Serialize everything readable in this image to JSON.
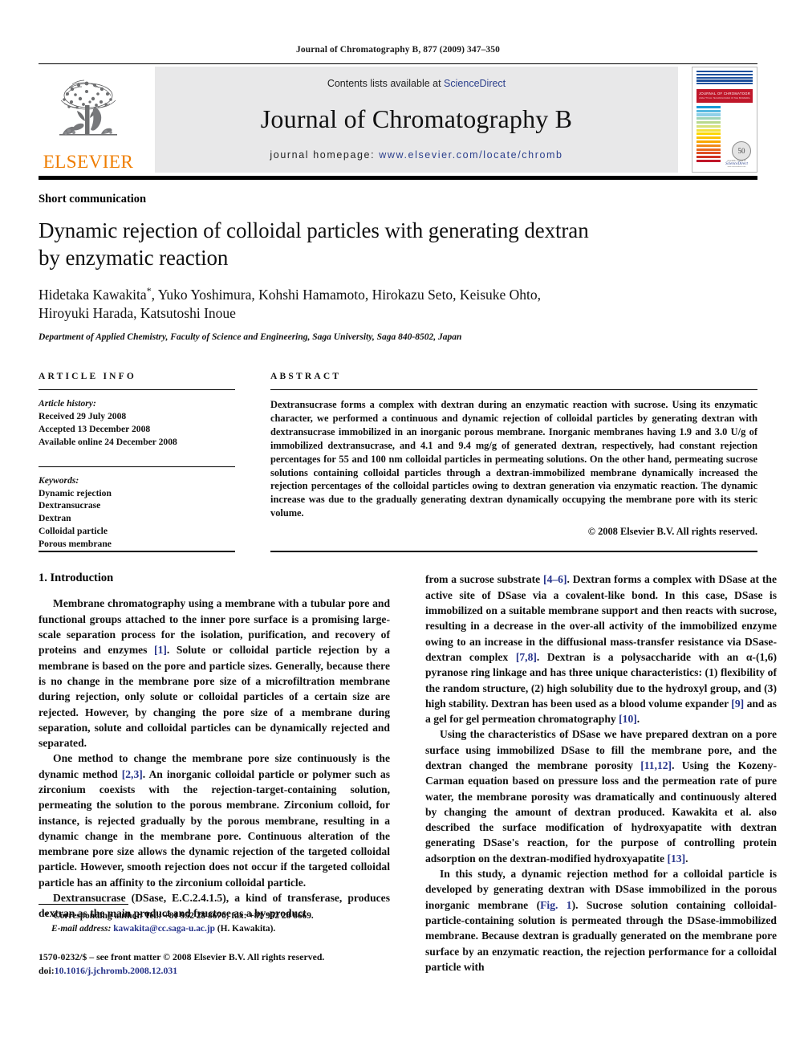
{
  "running_head": "Journal of Chromatography B, 877 (2009) 347–350",
  "masthead": {
    "publisher_name": "ELSEVIER",
    "contents_prefix": "Contents lists available at ",
    "contents_link": "ScienceDirect",
    "journal_title": "Journal of Chromatography B",
    "homepage_prefix": "journal homepage: ",
    "homepage_url": "www.elsevier.com/locate/chromb"
  },
  "cover": {
    "title": "JOURNAL OF CHROMATOGRAPHY B",
    "subtitle": "ANALYTICAL TECHNOLOGIES IN THE BIOMEDICAL AND LIFE SCIENCES",
    "badge": "50",
    "sd_top": "Available online at",
    "sd_name": "ScienceDirect",
    "sd_bottom": "www.sciencedirect.com",
    "top_bar_colors": [
      "#1b4f9c",
      "#1b4f9c",
      "#1b4f9c",
      "#1b4f9c",
      "#1b4f9c"
    ],
    "stripe_colors": [
      "#1a9ad6",
      "#55b8e0",
      "#8fd0e8",
      "#9ed3b7",
      "#b8d98e",
      "#d7e17a",
      "#f2e23a",
      "#fcd800",
      "#fcc200",
      "#f9a800",
      "#f18a1c",
      "#e96a20",
      "#de4d24",
      "#cf3224",
      "#c0172a"
    ]
  },
  "article": {
    "doctype": "Short communication",
    "title_line1": "Dynamic rejection of colloidal particles with generating dextran",
    "title_line2": "by enzymatic reaction",
    "authors_line1": "Hidetaka Kawakita",
    "authors_star": "*",
    "authors_line1_rest": ", Yuko Yoshimura, Kohshi Hamamoto, Hirokazu Seto, Keisuke Ohto,",
    "authors_line2": "Hiroyuki Harada, Katsutoshi Inoue",
    "affiliation": "Department of Applied Chemistry, Faculty of Science and Engineering, Saga University, Saga 840-8502, Japan"
  },
  "article_info": {
    "heading": "ARTICLE INFO",
    "history_label": "Article history:",
    "history": [
      "Received 29 July 2008",
      "Accepted 13 December 2008",
      "Available online 24 December 2008"
    ],
    "keywords_label": "Keywords:",
    "keywords": [
      "Dynamic rejection",
      "Dextransucrase",
      "Dextran",
      "Colloidal particle",
      "Porous membrane"
    ]
  },
  "abstract": {
    "heading": "ABSTRACT",
    "text": "Dextransucrase forms a complex with dextran during an enzymatic reaction with sucrose. Using its enzymatic character, we performed a continuous and dynamic rejection of colloidal particles by generating dextran with dextransucrase immobilized in an inorganic porous membrane. Inorganic membranes having 1.9 and 3.0 U/g of immobilized dextransucrase, and 4.1 and 9.4 mg/g of generated dextran, respectively, had constant rejection percentages for 55 and 100 nm colloidal particles in permeating solutions. On the other hand, permeating sucrose solutions containing colloidal particles through a dextran-immobilized membrane dynamically increased the rejection percentages of the colloidal particles owing to dextran generation via enzymatic reaction. The dynamic increase was due to the gradually generating dextran dynamically occupying the membrane pore with its steric volume.",
    "copyright": "© 2008 Elsevier B.V. All rights reserved."
  },
  "body": {
    "section_number_title": "1.  Introduction",
    "left_paragraphs": [
      "Membrane chromatography using a membrane with a tubular pore and functional groups attached to the inner pore surface is a promising large-scale separation process for the isolation, purification, and recovery of proteins and enzymes [1]. Solute or colloidal particle rejection by a membrane is based on the pore and particle sizes. Generally, because there is no change in the membrane pore size of a microfiltration membrane during rejection, only solute or colloidal particles of a certain size are rejected. However, by changing the pore size of a membrane during separation, solute and colloidal particles can be dynamically rejected and separated.",
      "One method to change the membrane pore size continuously is the dynamic method [2,3]. An inorganic colloidal particle or polymer such as zirconium coexists with the rejection-target-containing solution, permeating the solution to the porous membrane. Zirconium colloid, for instance, is rejected gradually by the porous membrane, resulting in a dynamic change in the membrane pore. Continuous alteration of the membrane pore size allows the dynamic rejection of the targeted colloidal particle. However, smooth rejection does not occur if the targeted colloidal particle has an affinity to the zirconium colloidal particle.",
      "Dextransucrase (DSase, E.C.2.4.1.5), a kind of transferase, produces dextran as the main product and fructose as a by-product"
    ],
    "right_paragraphs": [
      "from a sucrose substrate [4–6]. Dextran forms a complex with DSase at the active site of DSase via a covalent-like bond. In this case, DSase is immobilized on a suitable membrane support and then reacts with sucrose, resulting in a decrease in the over-all activity of the immobilized enzyme owing to an increase in the diffusional mass-transfer resistance via DSase-dextran complex [7,8]. Dextran is a polysaccharide with an α-(1,6) pyranose ring linkage and has three unique characteristics: (1) flexibility of the random structure, (2) high solubility due to the hydroxyl group, and (3) high stability. Dextran has been used as a blood volume expander [9] and as a gel for gel permeation chromatography [10].",
      "Using the characteristics of DSase we have prepared dextran on a pore surface using immobilized DSase to fill the membrane pore, and the dextran changed the membrane porosity [11,12]. Using the Kozeny-Carman equation based on pressure loss and the permeation rate of pure water, the membrane porosity was dramatically and continuously altered by changing the amount of dextran produced. Kawakita et al. also described the surface modification of hydroxyapatite with dextran generating DSase's reaction, for the purpose of controlling protein adsorption on the dextran-modified hydroxyapatite [13].",
      "In this study, a dynamic rejection method for a colloidal particle is developed by generating dextran with DSase immobilized in the porous inorganic membrane (Fig. 1). Sucrose solution containing colloidal-particle-containing solution is permeated through the DSase-immobilized membrane. Because dextran is gradually generated on the membrane pore surface by an enzymatic reaction, the rejection performance for a colloidal particle with"
    ]
  },
  "footnote": {
    "star": "*",
    "corresponding": "Corresponding author. Tel.: +81 952 28 8670; fax: +81 952 28 8669.",
    "email_label": "E-mail address:",
    "email": "kawakita@cc.saga-u.ac.jp",
    "email_suffix": "(H. Kawakita)."
  },
  "colophon": {
    "line1": "1570-0232/$ – see front matter © 2008 Elsevier B.V. All rights reserved.",
    "doi_label": "doi:",
    "doi": "10.1016/j.jchromb.2008.12.031"
  }
}
